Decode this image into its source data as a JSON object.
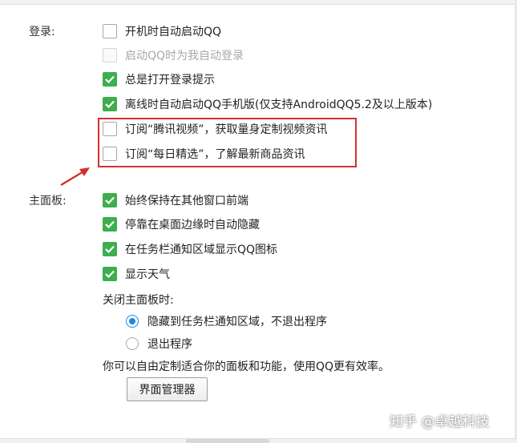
{
  "login": {
    "section_label": "登录:",
    "options": [
      {
        "label": "开机时自动启动QQ",
        "checked": false,
        "disabled": false
      },
      {
        "label": "启动QQ时为我自动登录",
        "checked": false,
        "disabled": true
      },
      {
        "label": "总是打开登录提示",
        "checked": true,
        "disabled": false
      },
      {
        "label": "离线时自动启动QQ手机版(仅支持AndroidQQ5.2及以上版本)",
        "checked": true,
        "disabled": false
      },
      {
        "label": "订阅“腾讯视频”，获取量身定制视频资讯",
        "checked": false,
        "disabled": false
      },
      {
        "label": "订阅“每日精选”，了解最新商品资讯",
        "checked": false,
        "disabled": false
      }
    ]
  },
  "main_panel": {
    "section_label": "主面板:",
    "options": [
      {
        "label": "始终保持在其他窗口前端",
        "checked": true
      },
      {
        "label": "停靠在桌面边缘时自动隐藏",
        "checked": true
      },
      {
        "label": "在任务栏通知区域显示QQ图标",
        "checked": true
      },
      {
        "label": "显示天气",
        "checked": true
      }
    ],
    "close_label": "关闭主面板时:",
    "close_options": [
      {
        "label": "隐藏到任务栏通知区域，不退出程序",
        "selected": true
      },
      {
        "label": "退出程序",
        "selected": false
      }
    ],
    "customize_text": "你可以自由定制适合你的面板和功能，使用QQ更有效率。",
    "manager_button": "界面管理器"
  },
  "watermark": "知乎 @卓越科技",
  "colors": {
    "check_green": "#3dae4f",
    "radio_blue": "#1e88e5",
    "highlight_red": "#d32f2f"
  }
}
